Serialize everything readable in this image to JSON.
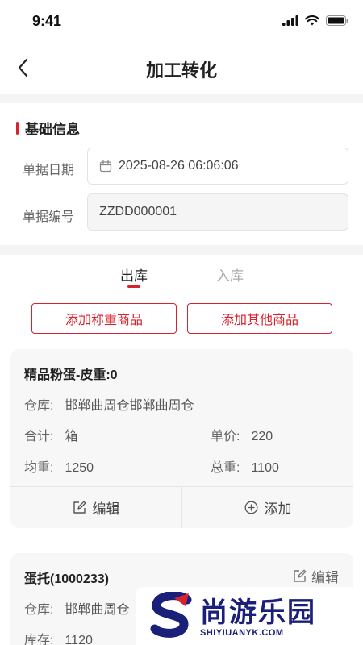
{
  "status": {
    "time": "9:41"
  },
  "nav": {
    "title": "加工转化"
  },
  "basic": {
    "section_title": "基础信息",
    "date_label": "单据日期",
    "date_value": "2025-08-26 06:06:06",
    "number_label": "单据编号",
    "number_value": "ZZDD000001"
  },
  "tabs": [
    {
      "label": "出库",
      "active": true
    },
    {
      "label": "入库",
      "active": false
    }
  ],
  "buttons": {
    "add_weighed": "添加称重商品",
    "add_other": "添加其他商品"
  },
  "items": [
    {
      "name": "精品粉蛋-皮重:0",
      "warehouse_label": "仓库:",
      "warehouse": "邯郸曲周仓邯郸曲周仓",
      "total_label": "合计:",
      "total": "箱",
      "price_label": "单价:",
      "price": "220",
      "avg_label": "均重:",
      "avg": "1250",
      "gross_label": "总重:",
      "gross": "1100",
      "edit_label": "编辑",
      "add_label": "添加"
    },
    {
      "name": "蛋托(1000233)",
      "edit_label": "编辑",
      "warehouse_label": "仓库:",
      "warehouse": "邯郸曲周仓",
      "stock_label": "库存:",
      "stock": "1120"
    }
  ],
  "watermark": {
    "brand": "尚游乐园",
    "domain": "SHIYIUANYK.COM"
  },
  "colors": {
    "accent": "#d8222c",
    "background": "#f4f4f4",
    "card": "#f7f7f7",
    "watermark": "#1a1f7a"
  }
}
